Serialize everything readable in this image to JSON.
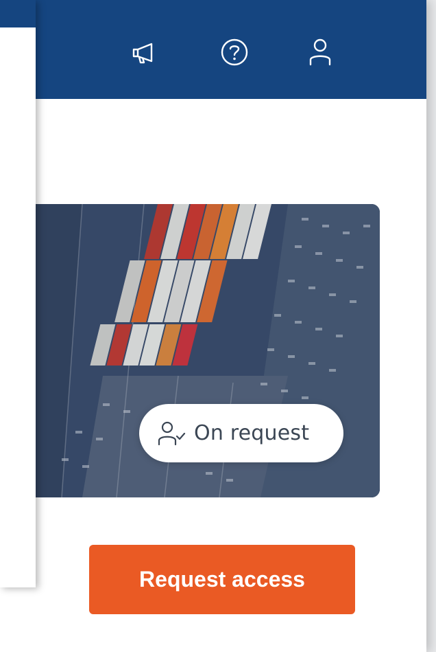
{
  "header": {
    "icons": [
      "megaphone-icon",
      "help-icon",
      "user-icon"
    ],
    "background_color": "#154580"
  },
  "card": {
    "image_subject": "aerial view of shipping container terminal",
    "badge": {
      "icon": "user-check-icon",
      "label": "On request"
    }
  },
  "actions": {
    "request_access_label": "Request access",
    "accent_color": "#EA5A24"
  }
}
